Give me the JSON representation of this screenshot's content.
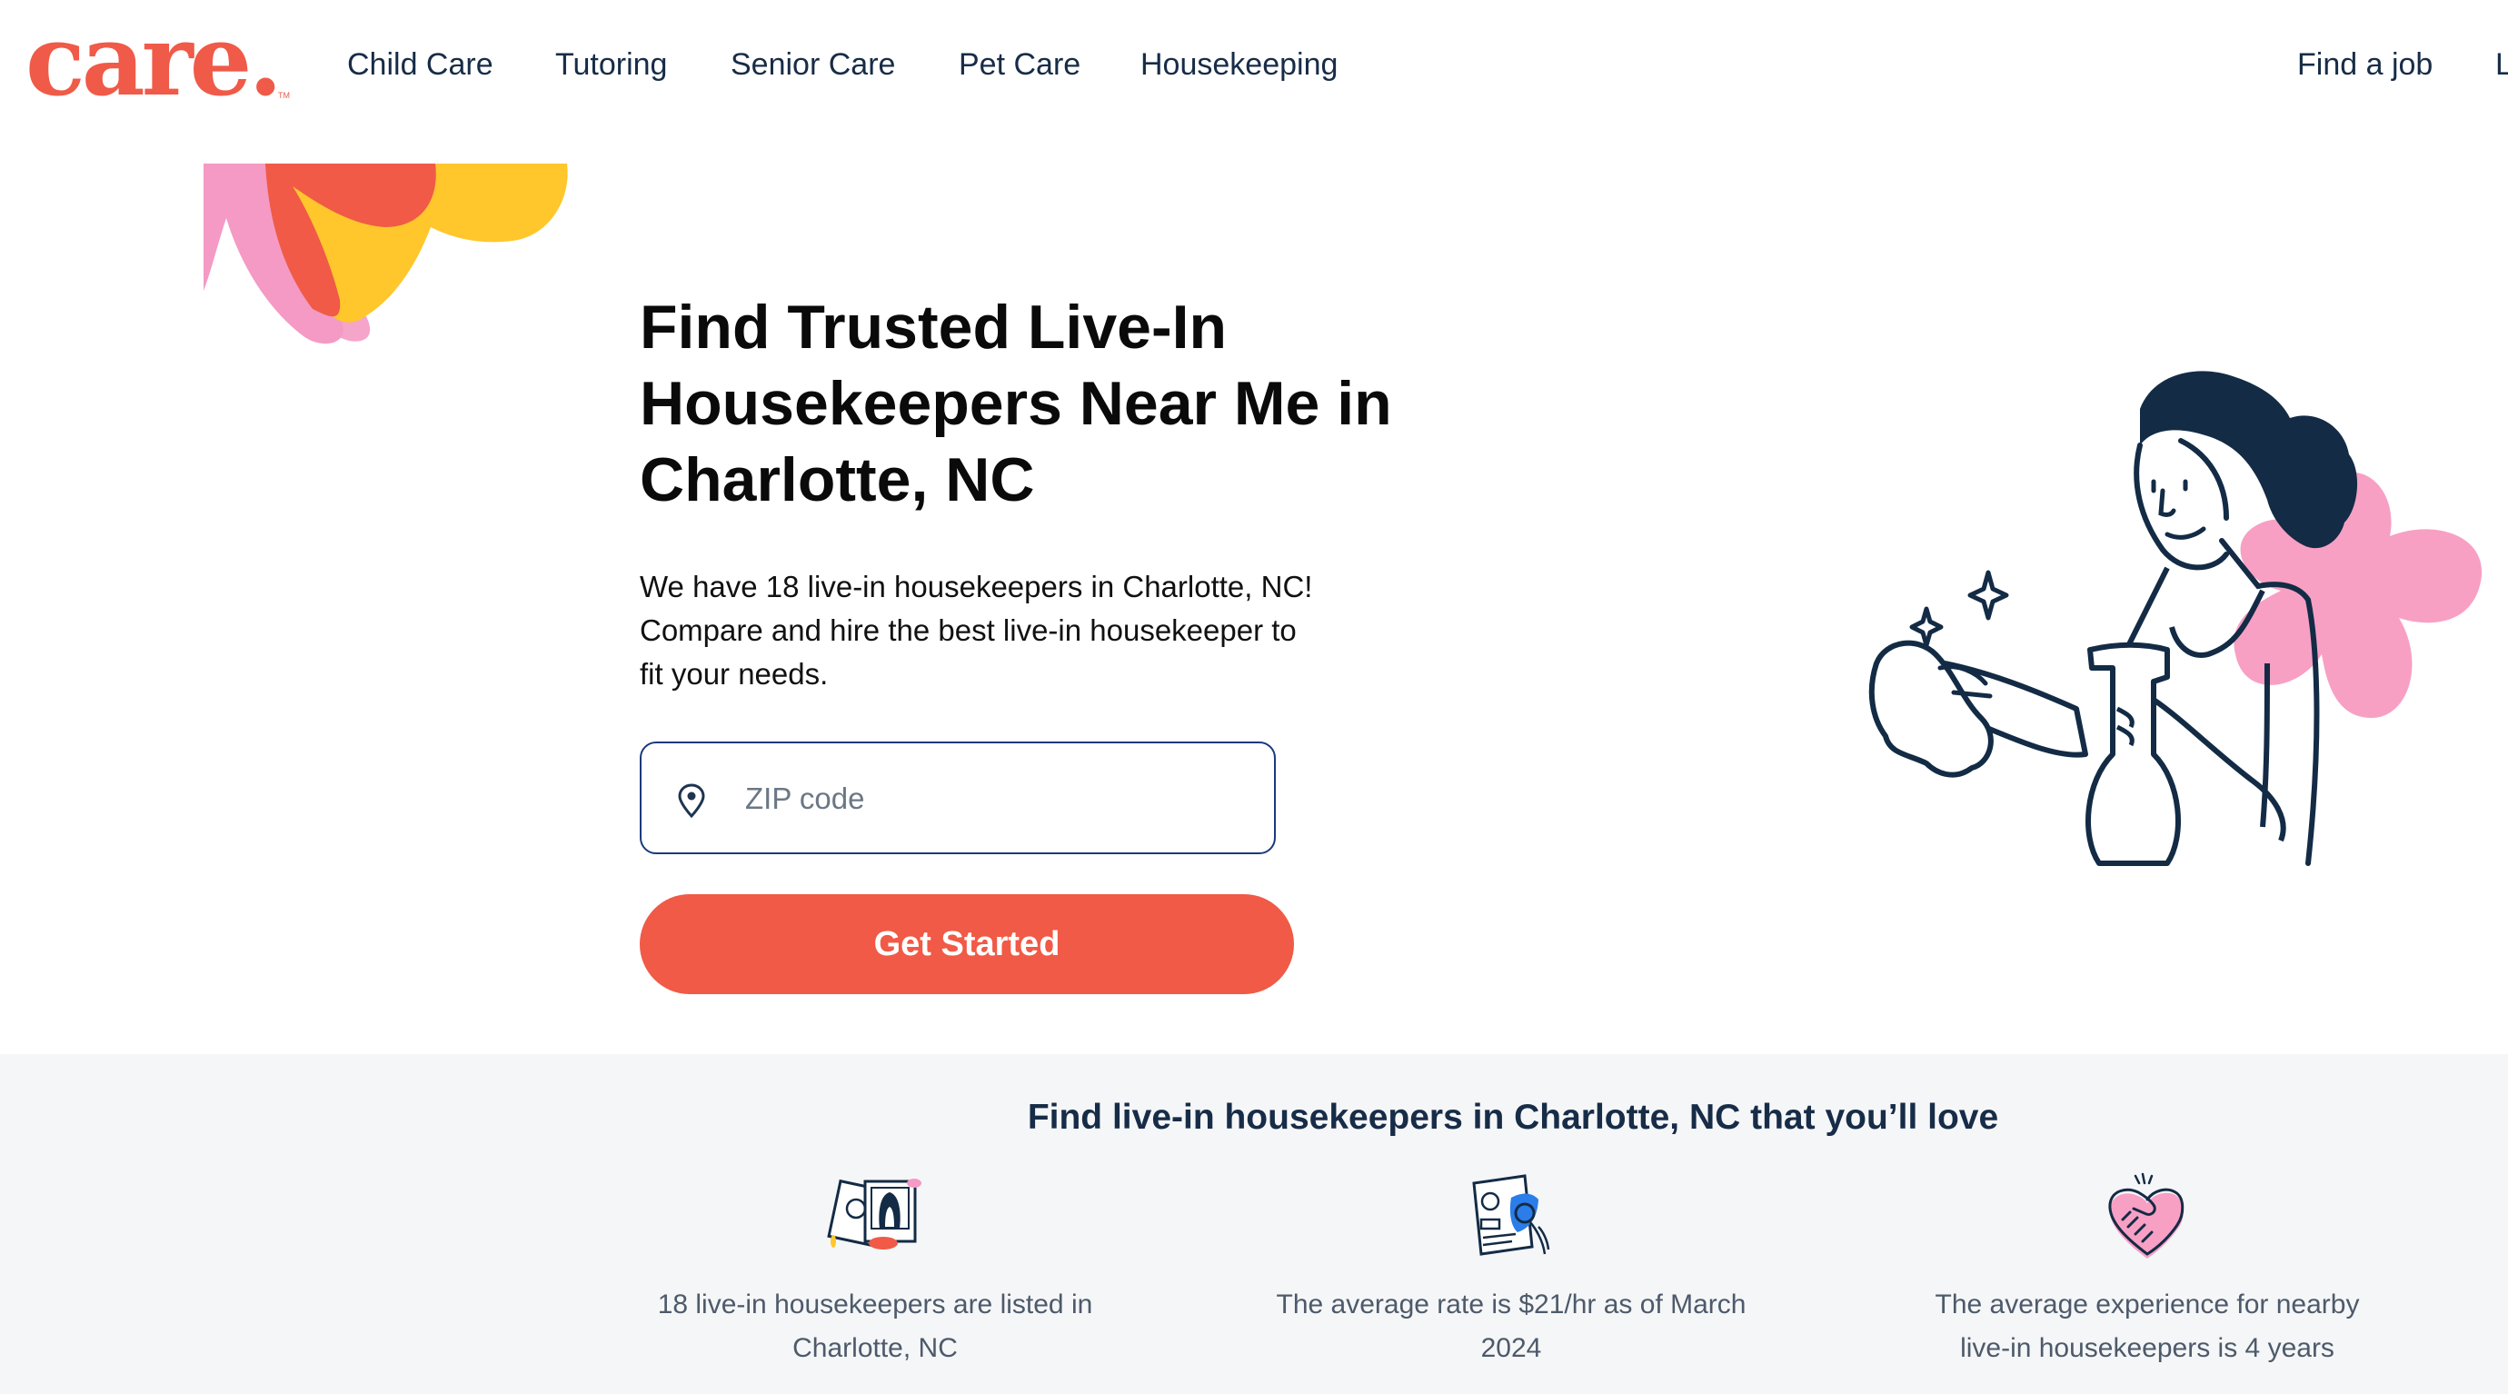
{
  "brand": {
    "logo_text": "care.",
    "logo_tm": "TM",
    "color": "#f05a48"
  },
  "nav": {
    "items": [
      {
        "label": "Child Care"
      },
      {
        "label": "Tutoring"
      },
      {
        "label": "Senior Care"
      },
      {
        "label": "Pet Care"
      },
      {
        "label": "Housekeeping"
      }
    ],
    "right_items": [
      {
        "label": "Find a job"
      },
      {
        "label": "L"
      }
    ]
  },
  "hero": {
    "title_lines": [
      "Find Trusted Live-In",
      "Housekeepers Near Me in",
      "Charlotte, NC"
    ],
    "description_lines": [
      "We have 18 live-in housekeepers in Charlotte, NC!",
      "Compare and hire the best live-in housekeeper to",
      "fit your needs."
    ],
    "zip": {
      "placeholder": "ZIP code",
      "value": "",
      "icon": "location-pin-icon"
    },
    "cta_label": "Get Started",
    "illustration": "woman-cleaning-with-spray-bottle"
  },
  "features": {
    "title": "Find live-in housekeepers in Charlotte, NC that you’ll love",
    "items": [
      {
        "icon": "profile-photos-icon",
        "lines": [
          "18 live-in housekeepers are listed in",
          "Charlotte, NC"
        ]
      },
      {
        "icon": "background-check-document-icon",
        "lines": [
          "The average rate is $21/hr as of March",
          "2024"
        ]
      },
      {
        "icon": "handshake-heart-icon",
        "lines": [
          "The average experience for nearby",
          "live-in housekeepers is 4 years"
        ]
      }
    ]
  },
  "colors": {
    "accent": "#f05a46",
    "navy": "#172c47",
    "input_border": "#1a3a7d",
    "section_bg": "#f5f6f8",
    "muted_text": "#4d5a6a"
  }
}
